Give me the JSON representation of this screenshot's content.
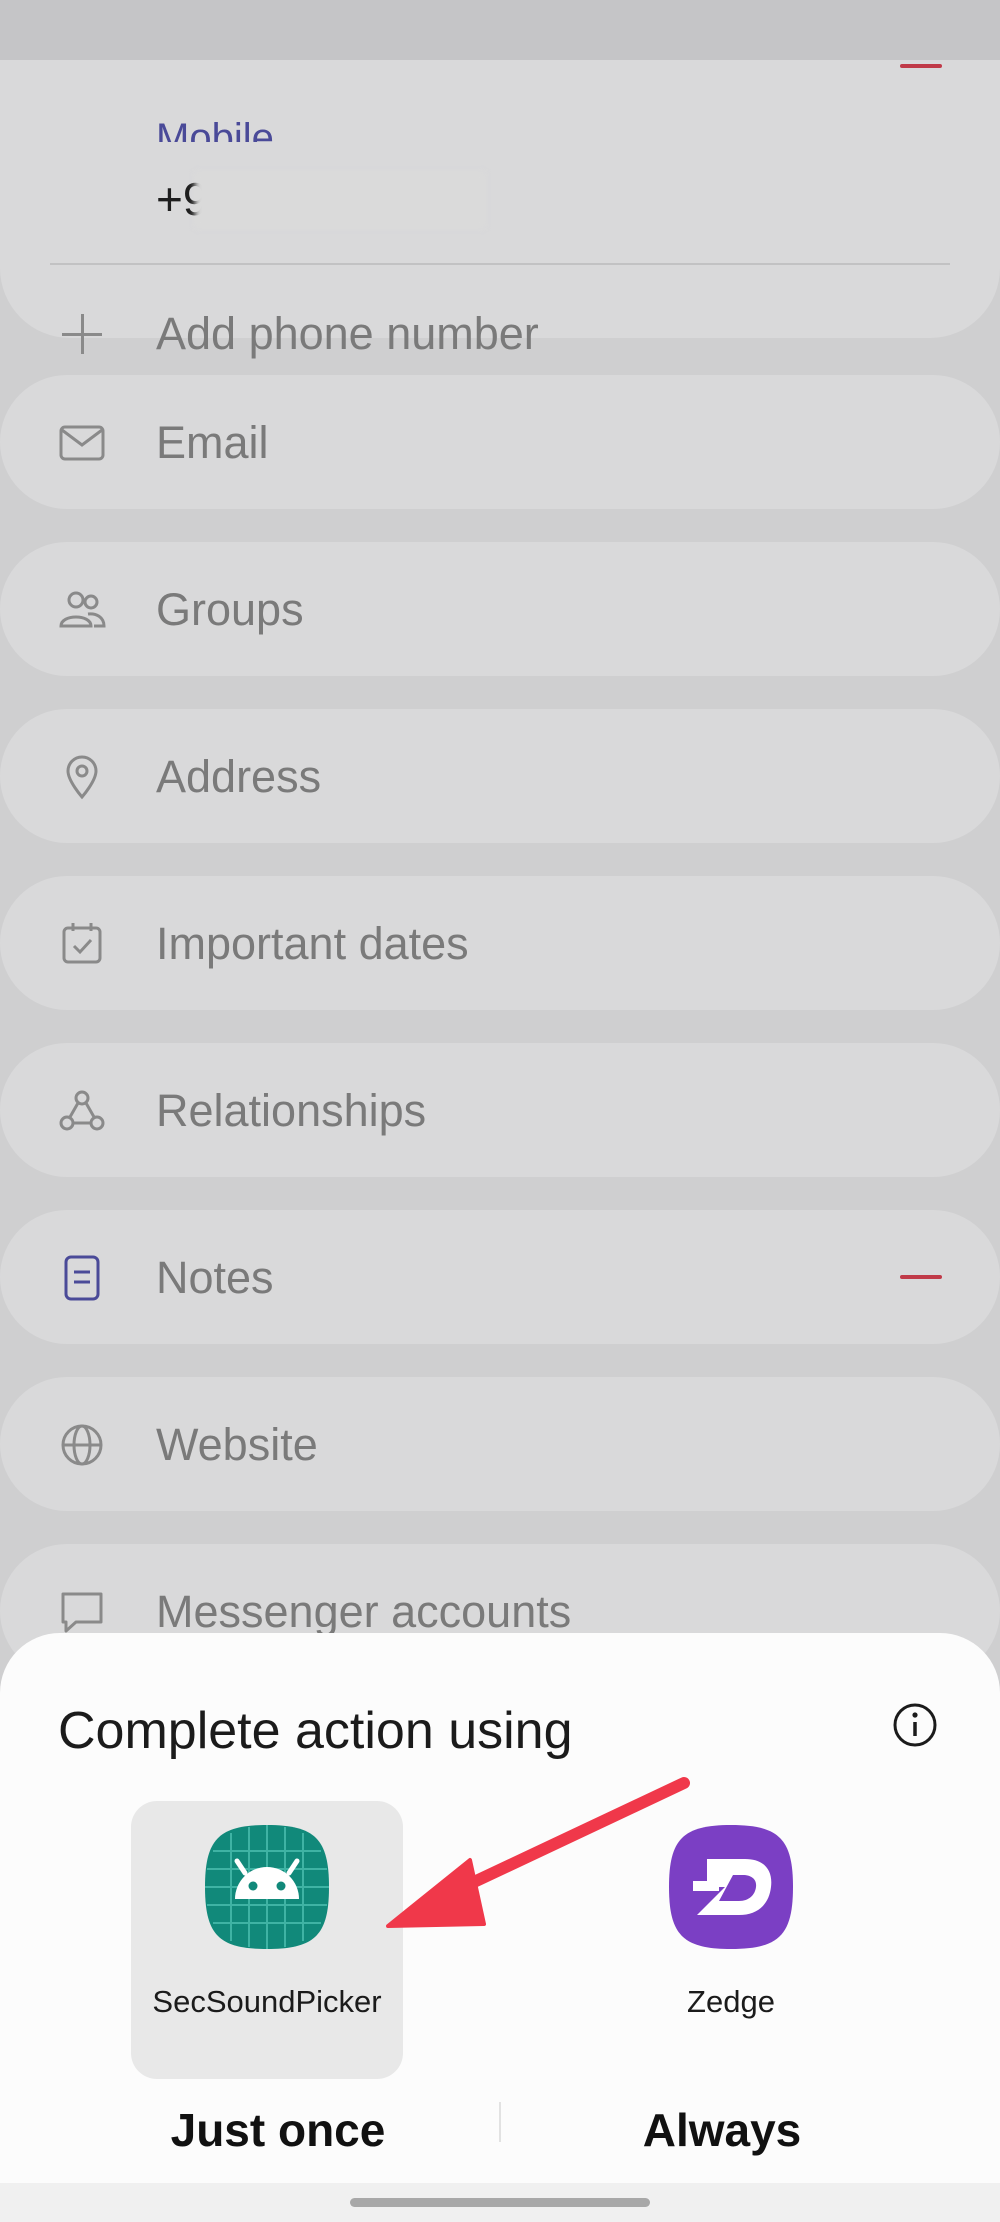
{
  "contact_form": {
    "phone_label": "Mobile",
    "phone_value": "+9",
    "add_phone_label": "Add phone number",
    "fields": [
      {
        "label": "Email",
        "icon": "mail-icon"
      },
      {
        "label": "Groups",
        "icon": "groups-icon"
      },
      {
        "label": "Address",
        "icon": "location-pin-icon"
      },
      {
        "label": "Important dates",
        "icon": "calendar-icon"
      },
      {
        "label": "Relationships",
        "icon": "relationships-icon"
      },
      {
        "label": "Notes",
        "icon": "notes-icon"
      },
      {
        "label": "Website",
        "icon": "globe-icon"
      },
      {
        "label": "Messenger accounts",
        "icon": "chat-bubble-icon"
      }
    ]
  },
  "chooser": {
    "title": "Complete action using",
    "apps": [
      {
        "name": "SecSoundPicker",
        "icon": "android-icon",
        "color": "#11897a",
        "selected": true
      },
      {
        "name": "Zedge",
        "icon": "zedge-logo",
        "color": "#7b3fc4",
        "selected": false
      }
    ],
    "just_once_label": "Just once",
    "always_label": "Always"
  },
  "colors": {
    "scrim_background": "#cfcfd0",
    "accent_red": "#c03a48",
    "annotation_arrow": "#f0384a"
  }
}
